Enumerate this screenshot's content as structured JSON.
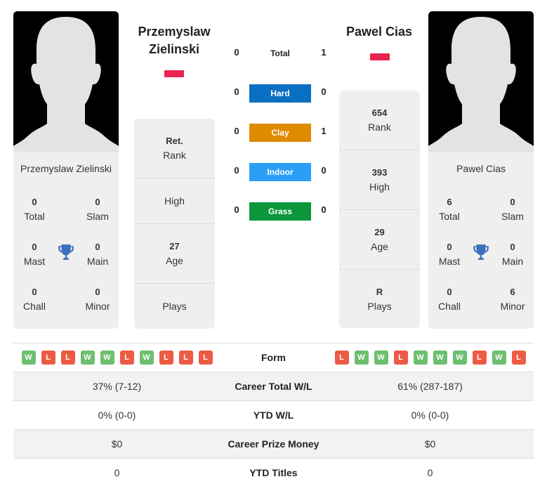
{
  "players": {
    "left": {
      "name": "Przemyslaw Zielinski",
      "title_line1": "Przemyslaw",
      "title_line2": "Zielinski",
      "flag_color": "#e8244f",
      "titles": {
        "total": {
          "value": "0",
          "label": "Total"
        },
        "slam": {
          "value": "0",
          "label": "Slam"
        },
        "mast": {
          "value": "0",
          "label": "Mast"
        },
        "main": {
          "value": "0",
          "label": "Main"
        },
        "chall": {
          "value": "0",
          "label": "Chall"
        },
        "minor": {
          "value": "0",
          "label": "Minor"
        }
      },
      "info": {
        "rank": {
          "value": "Ret.",
          "label": "Rank"
        },
        "high": {
          "value": "",
          "label": "High"
        },
        "age": {
          "value": "27",
          "label": "Age"
        },
        "plays": {
          "value": "",
          "label": "Plays"
        }
      }
    },
    "right": {
      "name": "Pawel Cias",
      "title_line1": "Pawel Cias",
      "flag_color": "#e8244f",
      "titles": {
        "total": {
          "value": "6",
          "label": "Total"
        },
        "slam": {
          "value": "0",
          "label": "Slam"
        },
        "mast": {
          "value": "0",
          "label": "Mast"
        },
        "main": {
          "value": "0",
          "label": "Main"
        },
        "chall": {
          "value": "0",
          "label": "Chall"
        },
        "minor": {
          "value": "6",
          "label": "Minor"
        }
      },
      "info": {
        "rank": {
          "value": "654",
          "label": "Rank"
        },
        "high": {
          "value": "393",
          "label": "High"
        },
        "age": {
          "value": "29",
          "label": "Age"
        },
        "plays": {
          "value": "R",
          "label": "Plays"
        }
      }
    }
  },
  "h2h": [
    {
      "label": "Total",
      "left": "0",
      "right": "1",
      "color": ""
    },
    {
      "label": "Hard",
      "left": "0",
      "right": "0",
      "color": "#0a6fc2"
    },
    {
      "label": "Clay",
      "left": "0",
      "right": "1",
      "color": "#de8b00"
    },
    {
      "label": "Indoor",
      "left": "0",
      "right": "0",
      "color": "#2b9ff5"
    },
    {
      "label": "Grass",
      "left": "0",
      "right": "0",
      "color": "#0a9639"
    }
  ],
  "form": {
    "label": "Form",
    "left": [
      "W",
      "L",
      "L",
      "W",
      "W",
      "L",
      "W",
      "L",
      "L",
      "L"
    ],
    "right": [
      "L",
      "W",
      "W",
      "L",
      "W",
      "W",
      "W",
      "L",
      "W",
      "L"
    ]
  },
  "stats": [
    {
      "label": "Career Total W/L",
      "left": "37% (7-12)",
      "right": "61% (287-187)"
    },
    {
      "label": "YTD W/L",
      "left": "0% (0-0)",
      "right": "0% (0-0)"
    },
    {
      "label": "Career Prize Money",
      "left": "$0",
      "right": "$0"
    },
    {
      "label": "YTD Titles",
      "left": "0",
      "right": "0"
    }
  ],
  "icons": {
    "trophy": "trophy-icon",
    "avatar": "player-silhouette"
  }
}
